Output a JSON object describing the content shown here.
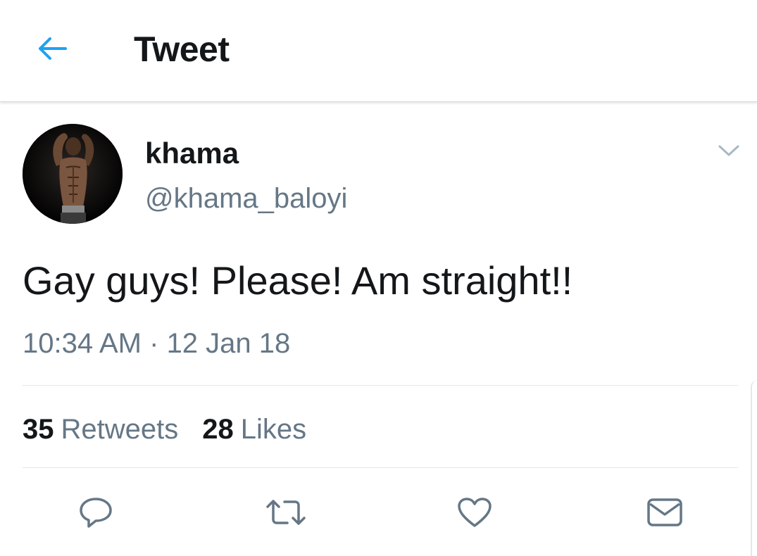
{
  "header": {
    "title": "Tweet",
    "back_icon": "arrow-left-icon"
  },
  "colors": {
    "accent": "#1da1f2",
    "text": "#14171a",
    "secondary": "#657786",
    "divider": "#e1e8ed"
  },
  "tweet": {
    "author": {
      "display_name": "khama",
      "handle": "@khama_baloyi"
    },
    "text": "Gay guys! Please! Am straight!!",
    "time": "10:34 AM",
    "separator": " · ",
    "date": "12 Jan 18"
  },
  "stats": {
    "retweets_count": "35",
    "retweets_label": "Retweets",
    "likes_count": "28",
    "likes_label": "Likes"
  },
  "actions": [
    {
      "icon": "reply-icon"
    },
    {
      "icon": "retweet-icon"
    },
    {
      "icon": "like-heart-icon"
    },
    {
      "icon": "direct-message-icon"
    }
  ]
}
